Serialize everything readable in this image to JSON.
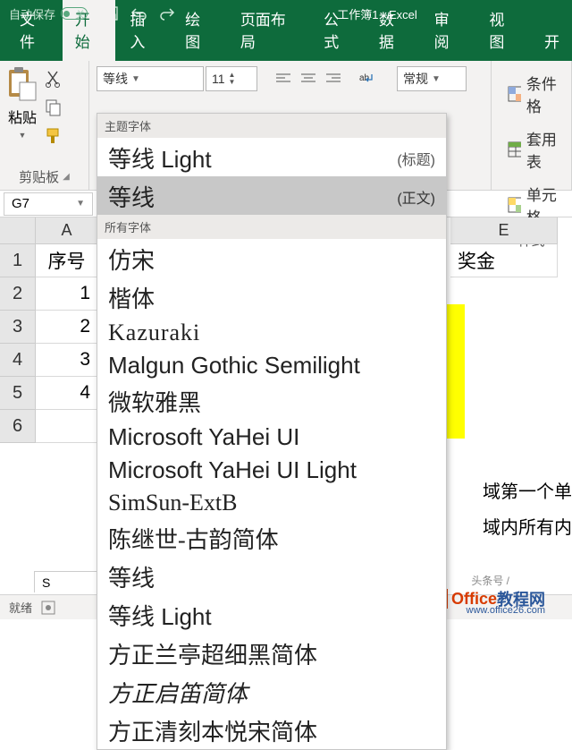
{
  "titlebar": {
    "autosave_label": "自动保存",
    "autosave_state": "关",
    "title": "工作簿1 - Excel"
  },
  "tabs": {
    "file": "文件",
    "home": "开始",
    "insert": "插入",
    "draw": "绘图",
    "layout": "页面布局",
    "formulas": "公式",
    "data": "数据",
    "review": "审阅",
    "view": "视图",
    "dev": "开"
  },
  "ribbon": {
    "clipboard": {
      "paste": "粘贴",
      "group_label": "剪贴板"
    },
    "font": {
      "name": "等线",
      "size": "11",
      "number_format": "常规"
    },
    "styles": {
      "cond_fmt": "条件格",
      "table_fmt": "套用表",
      "cell_styles": "单元格",
      "group_label": "样式"
    }
  },
  "font_dropdown": {
    "section_theme": "主题字体",
    "theme_items": [
      {
        "name": "等线 Light",
        "tag": "(标题)"
      },
      {
        "name": "等线",
        "tag": "(正文)"
      }
    ],
    "section_all": "所有字体",
    "all_items": [
      "仿宋",
      "楷体",
      "Kazuraki",
      "Malgun Gothic Semilight",
      "微软雅黑",
      "Microsoft YaHei UI",
      "Microsoft YaHei UI Light",
      "SimSun-ExtB",
      "陈继世-古韵简体",
      "等线",
      "等线 Light",
      "方正兰亭超细黑简体",
      "方正启笛简体",
      "方正清刻本悦宋简体"
    ]
  },
  "name_box": "G7",
  "columns": {
    "A": "A",
    "E": "E"
  },
  "rows": [
    "1",
    "2",
    "3",
    "4",
    "5",
    "6"
  ],
  "cells": {
    "A_header": "序号",
    "E_header": "奖金",
    "A_vals": [
      "1",
      "2",
      "3",
      "4"
    ]
  },
  "partial": {
    "line1": "域第一个单",
    "line2": "域内所有内"
  },
  "sheet_tab": "S",
  "status": "就绪",
  "watermark": {
    "headline": "头条号 /",
    "brand1": "Office",
    "brand2": "教程网",
    "url": "www.office26.com"
  }
}
